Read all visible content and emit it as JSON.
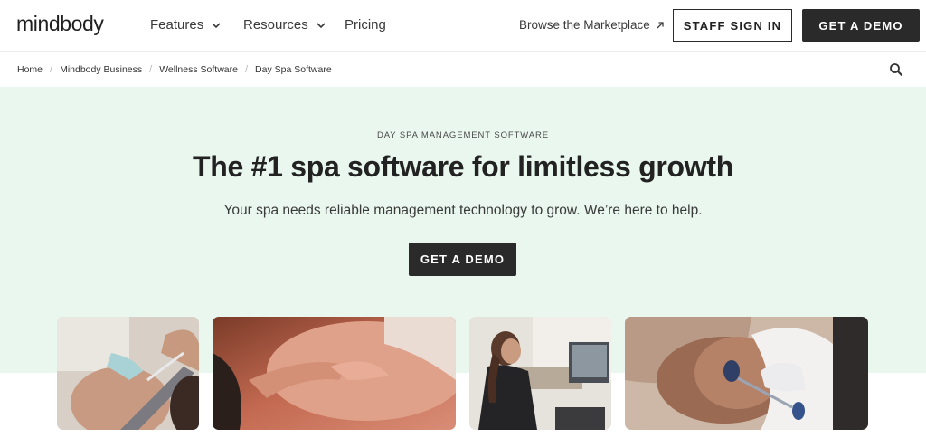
{
  "header": {
    "logo": "mindbody",
    "nav": [
      {
        "label": "Features",
        "icon": "chevron-down-icon"
      },
      {
        "label": "Resources",
        "icon": "chevron-down-icon"
      },
      {
        "label": "Pricing"
      }
    ],
    "marketplace_label": "Browse the Marketplace",
    "staff_signin_label": "STAFF SIGN IN",
    "demo_label": "GET A DEMO"
  },
  "breadcrumb": [
    "Home",
    "Mindbody Business",
    "Wellness Software",
    "Day Spa Software"
  ],
  "hero": {
    "eyebrow": "DAY SPA MANAGEMENT SOFTWARE",
    "headline": "The #1 spa software for limitless growth",
    "subhead": "Your spa needs reliable management technology to grow. We’re here to help.",
    "cta_label": "GET A DEMO",
    "background_color": "#e9f7ee"
  },
  "colors": {
    "primary_button": "#2a2a2a",
    "text": "#222222"
  }
}
